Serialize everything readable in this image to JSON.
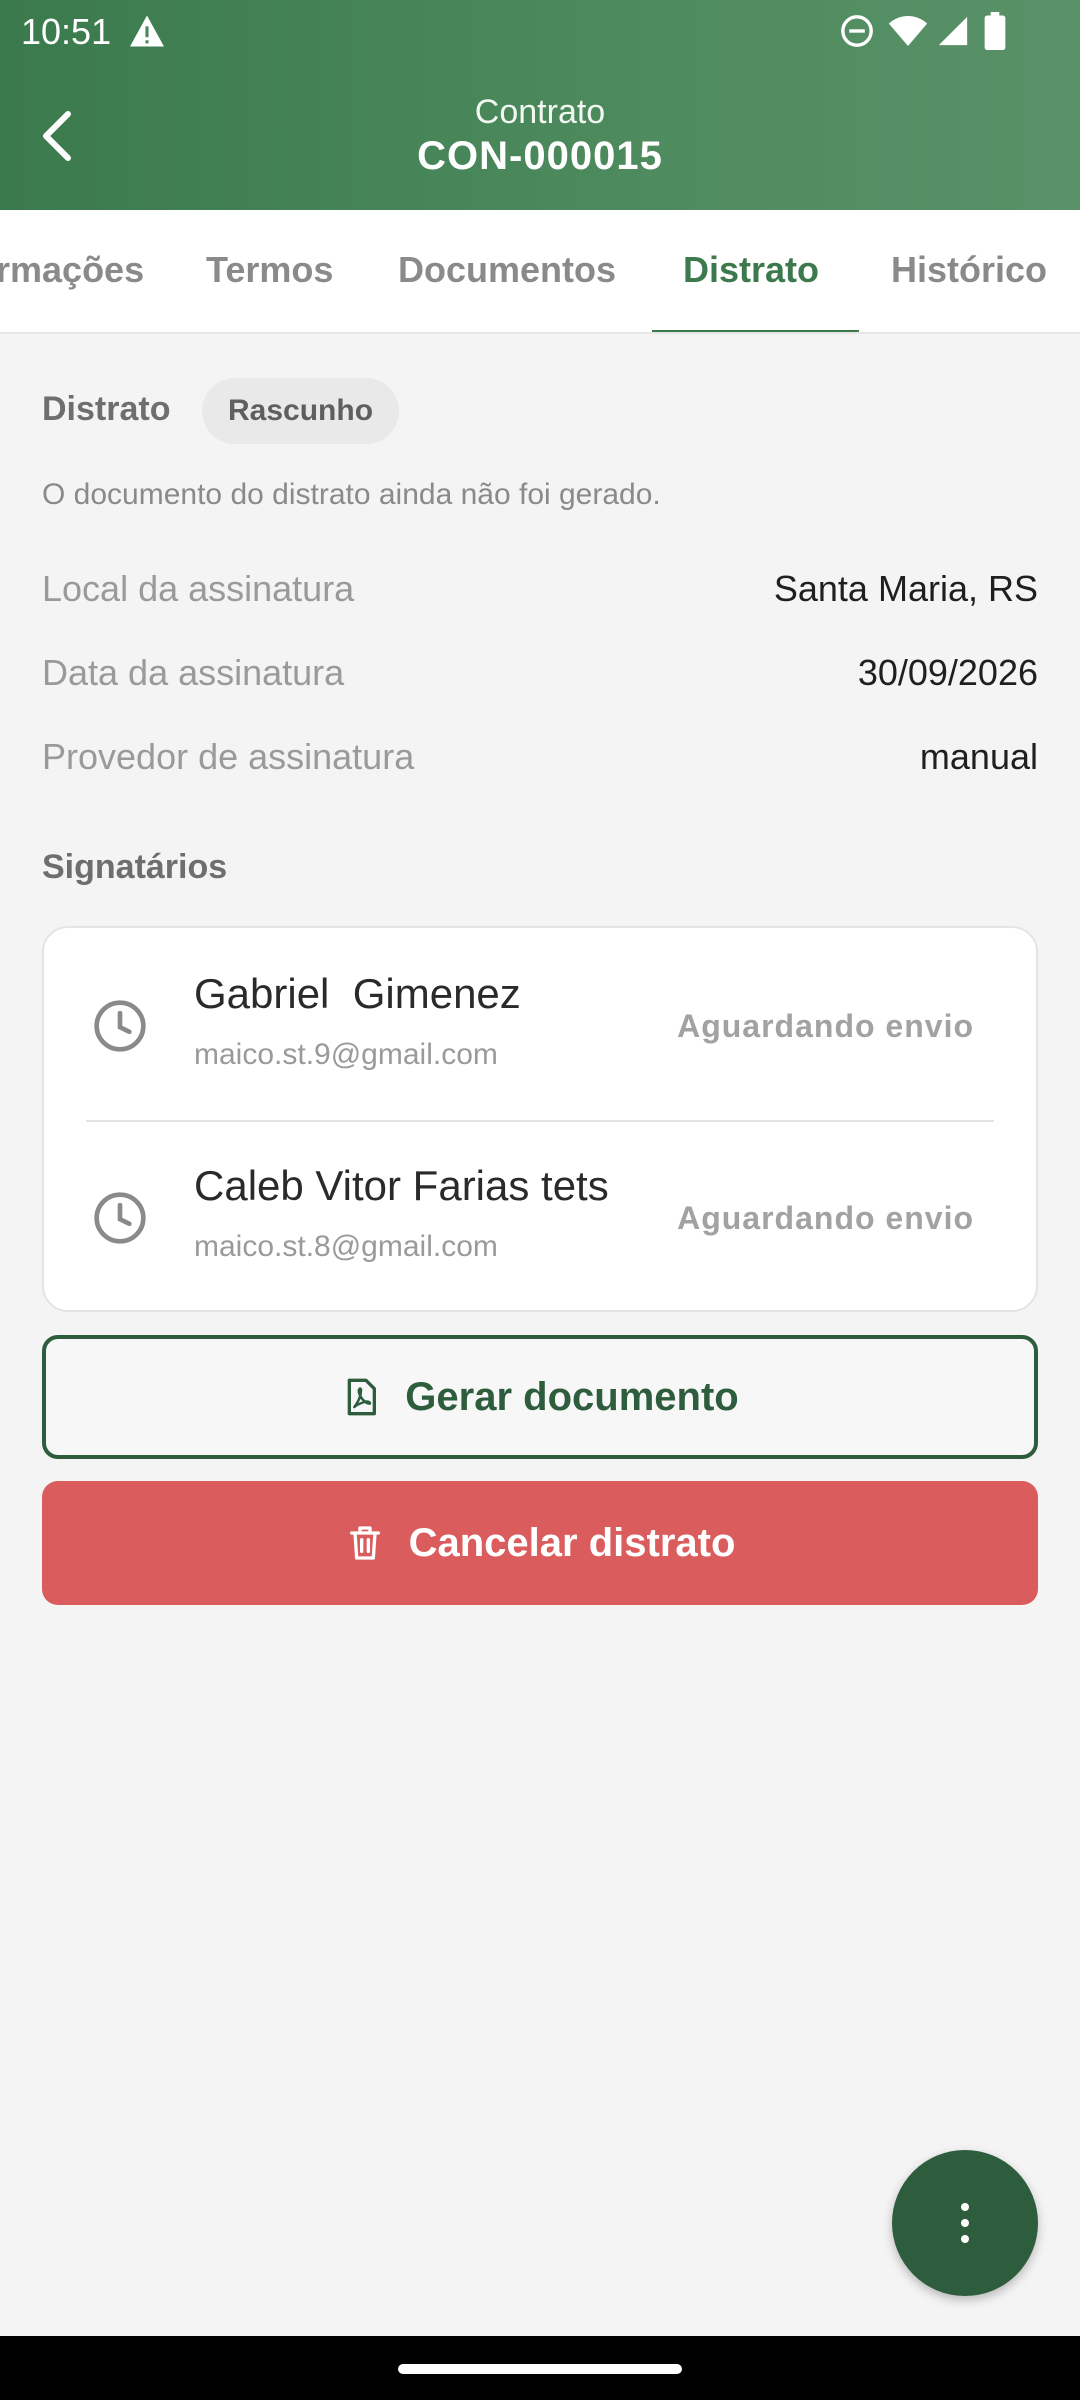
{
  "status_bar": {
    "time": "10:51",
    "icons": [
      "warning-icon",
      "do-not-disturb-icon",
      "wifi-icon",
      "signal-icon",
      "battery-icon"
    ]
  },
  "header": {
    "subtitle": "Contrato",
    "title": "CON-000015",
    "background_color": "#4c8a5d"
  },
  "tabs": [
    {
      "label": "rmações"
    },
    {
      "label": "Termos"
    },
    {
      "label": "Documentos"
    },
    {
      "label": "Distrato",
      "active": true
    },
    {
      "label": "Histórico"
    }
  ],
  "distrato": {
    "section_title": "Distrato",
    "status_chip": "Rascunho",
    "notice": "O documento do distrato ainda não foi gerado.",
    "info": [
      {
        "label": "Local da assinatura",
        "value": "Santa Maria, RS"
      },
      {
        "label": "Data da assinatura",
        "value": "30/09/2026"
      },
      {
        "label": "Provedor de assinatura",
        "value": "manual"
      }
    ]
  },
  "signers": {
    "title": "Signatários",
    "items": [
      {
        "name": "Gabriel  Gimenez",
        "email": "maico.st.9@gmail.com",
        "status": "Aguardando envio",
        "icon": "clock-icon"
      },
      {
        "name": "Caleb Vitor Farias tets",
        "email": "maico.st.8@gmail.com",
        "status": "Aguardando envio",
        "icon": "clock-icon"
      }
    ]
  },
  "actions": {
    "generate_label": "Gerar documento",
    "generate_icon": "pdf-file-icon",
    "cancel_label": "Cancelar distrato",
    "cancel_icon": "trash-icon",
    "accent_color": "#2d5d3c",
    "danger_color": "#db5c5c"
  },
  "fab": {
    "icon": "more-vertical-icon"
  }
}
